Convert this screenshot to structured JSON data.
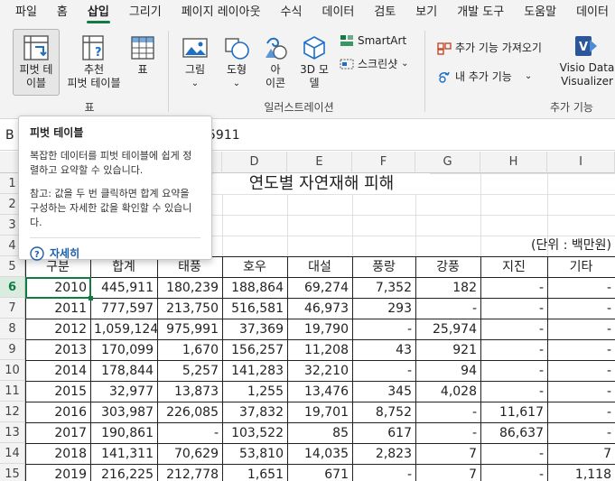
{
  "menu": {
    "tabs": [
      "파일",
      "홈",
      "삽입",
      "그리기",
      "페이지 레이아웃",
      "수식",
      "데이터",
      "검토",
      "보기",
      "개발 도구",
      "도움말",
      "데이터"
    ],
    "active_index": 2
  },
  "ribbon": {
    "pivot_table": "피벗 테\n이블",
    "recommended_pivot": "추천\n피벗 테이블",
    "table": "표",
    "picture": "그림",
    "shapes": "도형",
    "icons": "아\n이콘",
    "model_3d": "3D 모\n델",
    "smartart": "SmartArt",
    "screenshot": "스크린샷",
    "get_addins": "추가 기능 가져오기",
    "my_addins": "내 추가 기능",
    "visio": "Visio Data\nVisualizer",
    "group_tables": "표",
    "group_illustrations": "일러스트레이션",
    "group_addins": "추가 기능"
  },
  "formula_bar": {
    "name_box": "B",
    "value": "5911"
  },
  "tooltip": {
    "title": "피벗 테이블",
    "line1": "복잡한 데이터를 피벗 테이블에 쉽게 정렬하고 요약할 수 있습니다.",
    "line2": "참고: 값을 두 번 클릭하면 합계 요약을 구성하는 자세한 값을 확인할 수 있습니다.",
    "more": "자세히"
  },
  "sheet": {
    "columns": [
      "D",
      "E",
      "F",
      "G",
      "H",
      "I"
    ],
    "rows": [
      "1",
      "2",
      "3",
      "4",
      "5",
      "6",
      "7",
      "8",
      "9",
      "10",
      "11",
      "12",
      "13",
      "14",
      "15"
    ],
    "selected_row": "6",
    "title": "연도별 자연재해 피해",
    "unit": "(단위 : 백만원)",
    "headers": [
      "구분",
      "합계",
      "태풍",
      "호우",
      "대설",
      "풍랑",
      "강풍",
      "지진",
      "기타"
    ],
    "data": [
      [
        "2010",
        "445,911",
        "180,239",
        "188,864",
        "69,274",
        "7,352",
        "182",
        "-",
        "-"
      ],
      [
        "2011",
        "777,597",
        "213,750",
        "516,581",
        "46,973",
        "293",
        "-",
        "-",
        "-"
      ],
      [
        "2012",
        "1,059,124",
        "975,991",
        "37,369",
        "19,790",
        "-",
        "25,974",
        "-",
        "-"
      ],
      [
        "2013",
        "170,099",
        "1,670",
        "156,257",
        "11,208",
        "43",
        "921",
        "-",
        "-"
      ],
      [
        "2014",
        "178,844",
        "5,257",
        "141,283",
        "32,210",
        "-",
        "94",
        "-",
        "-"
      ],
      [
        "2015",
        "32,977",
        "13,873",
        "1,255",
        "13,476",
        "345",
        "4,028",
        "-",
        "-"
      ],
      [
        "2016",
        "303,987",
        "226,085",
        "37,832",
        "19,701",
        "8,752",
        "-",
        "11,617",
        "-"
      ],
      [
        "2017",
        "190,861",
        "-",
        "103,522",
        "85",
        "617",
        "-",
        "86,637",
        "-"
      ],
      [
        "2018",
        "141,311",
        "70,629",
        "53,810",
        "14,035",
        "2,823",
        "7",
        "-",
        "7"
      ],
      [
        "2019",
        "216,225",
        "212,778",
        "1,651",
        "671",
        "-",
        "7",
        "-",
        "1,118"
      ]
    ]
  },
  "colors": {
    "accent": "#107c41",
    "link": "#1d5fa8"
  }
}
